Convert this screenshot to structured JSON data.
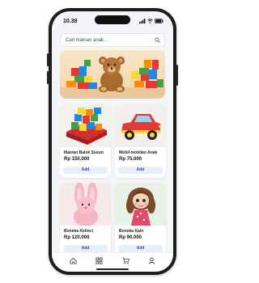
{
  "status_bar": {
    "time": "10.38"
  },
  "search": {
    "placeholder": "Cari mainan anak...",
    "icon": "search-icon"
  },
  "banner": {
    "alt": ""
  },
  "products": [
    {
      "name": "Mainan Balok Susun",
      "price": "Rp 150.000",
      "add_label": "Add",
      "image": "building-blocks"
    },
    {
      "name": "Mobil-mobilan Anak",
      "price": "Rp 75.000",
      "add_label": "Add",
      "image": "toy-car"
    },
    {
      "name": "Boneka Kelinci",
      "price": "Rp 120.000",
      "add_label": "Add",
      "image": "bunny-plush"
    },
    {
      "name": "Boneka Kain",
      "price": "Rp 90.000",
      "add_label": "Add",
      "image": "rag-doll"
    }
  ],
  "tab_bar": {
    "items": [
      "home-icon",
      "grid-icon",
      "cart-icon",
      "profile-icon"
    ]
  },
  "colors": {
    "accent": "#2a4fa8",
    "button_bg": "#e9eefb",
    "screen_bg": "#f3f5f8"
  }
}
